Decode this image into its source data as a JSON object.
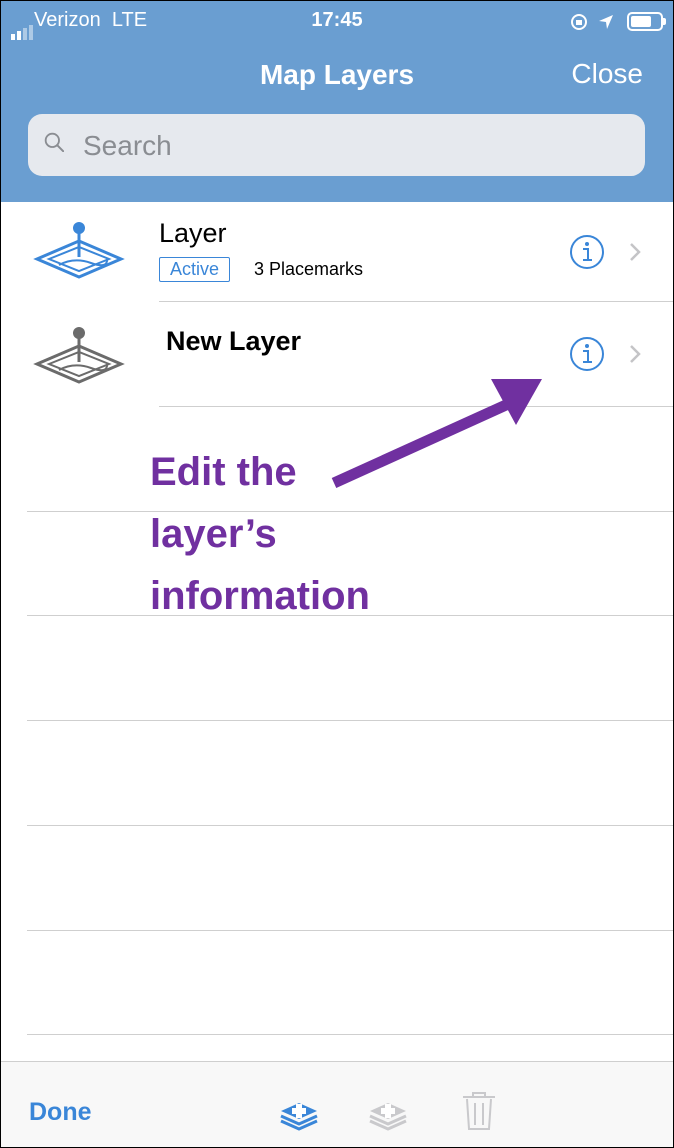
{
  "status_bar": {
    "carrier": "Verizon",
    "network": "LTE",
    "time": "17:45"
  },
  "header": {
    "title": "Map Layers",
    "close_label": "Close"
  },
  "search": {
    "placeholder": "Search"
  },
  "layers": [
    {
      "title": "Layer",
      "badge": "Active",
      "subtitle": "3 Placemarks"
    },
    {
      "title": "New Layer"
    }
  ],
  "annotation": {
    "line1": "Edit the",
    "line2": "layer’s",
    "line3": "information"
  },
  "toolbar": {
    "done_label": "Done"
  },
  "icons": {
    "layer_active": "map-layer-icon",
    "layer_inactive": "map-layer-icon",
    "info": "info-circle-icon",
    "chevron": "chevron-right-icon",
    "add_layer": "add-layer-icon",
    "duplicate_layer": "duplicate-layer-icon",
    "trash": "trash-icon"
  },
  "colors": {
    "header_bg": "#6a9ed1",
    "accent": "#3a86d8",
    "annotation": "#7030a0"
  }
}
